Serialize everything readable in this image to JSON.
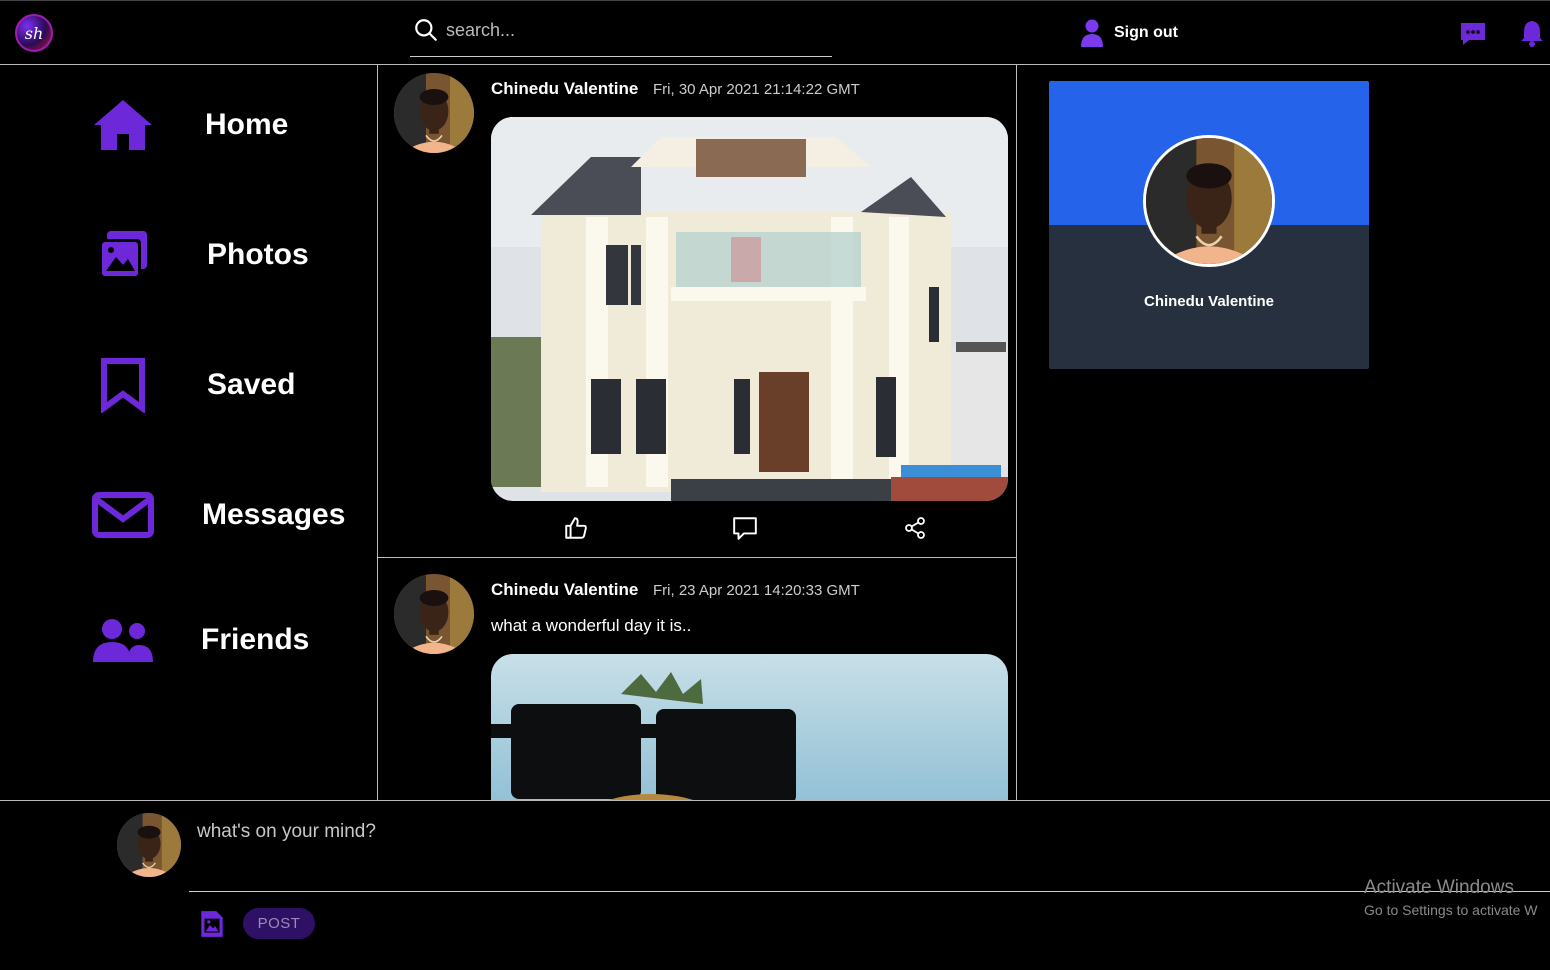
{
  "app": {
    "logo_text": "sh",
    "accent_color": "#6d28d9"
  },
  "header": {
    "search_placeholder": "search...",
    "signout_label": "Sign out",
    "icons": [
      "search-icon",
      "user-icon",
      "chat-icon",
      "bell-icon"
    ]
  },
  "sidebar": {
    "items": [
      {
        "label": "Home",
        "icon": "home-icon"
      },
      {
        "label": "Photos",
        "icon": "photos-icon"
      },
      {
        "label": "Saved",
        "icon": "bookmark-icon"
      },
      {
        "label": "Messages",
        "icon": "envelope-icon"
      },
      {
        "label": "Friends",
        "icon": "users-icon"
      }
    ]
  },
  "feed": {
    "posts": [
      {
        "author": "Chinedu Valentine",
        "date": "Fri, 30 Apr 2021 21:14:22 GMT",
        "text": "",
        "image": "white two-storey house photo",
        "actions": [
          "like-icon",
          "comment-icon",
          "share-icon"
        ]
      },
      {
        "author": "Chinedu Valentine",
        "date": "Fri, 23 Apr 2021 14:20:33 GMT",
        "text": "what a wonderful day it is..",
        "image": "pineapple wearing sunglasses photo"
      }
    ]
  },
  "profile": {
    "name": "Chinedu Valentine",
    "banner_color": "#2563eb",
    "card_color": "#27303f"
  },
  "composer": {
    "placeholder": "what's on your mind?",
    "post_label": "POST"
  },
  "os_watermark": {
    "line1": "Activate Windows",
    "line2": "Go to Settings to activate W"
  }
}
